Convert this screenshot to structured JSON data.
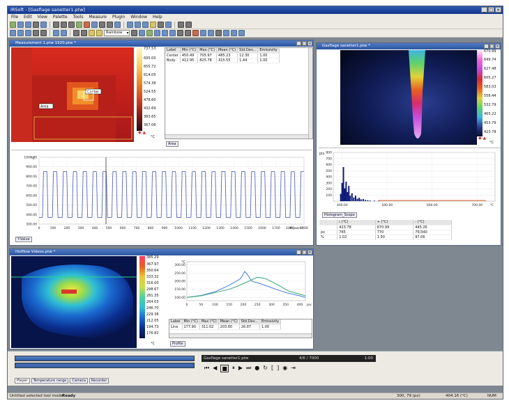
{
  "app": {
    "title": "IRSoft - [Gasflage sanetter1.ptw]"
  },
  "menu": [
    "File",
    "Edit",
    "View",
    "Palette",
    "Tools",
    "Measure",
    "Plugin",
    "Window",
    "Help"
  ],
  "toolbar": {
    "palette_combo": "Rainbow"
  },
  "win_a": {
    "title": "Measurement 1.ptw 1920.ptw *",
    "label_center": "Center",
    "label_area": "Area",
    "cbar_max": "737.53",
    "cbar_ticks": [
      "695.00",
      "655.72",
      "614.05",
      "574.38",
      "524.55",
      "478.60",
      "432.69",
      "383.65"
    ],
    "cbar_min": "367.06",
    "cbar_unit": "°C",
    "table": {
      "headers": [
        "Label",
        "Min (°C)",
        "Max (°C)",
        "Mean (°C)",
        "Std.Dev...",
        "Emissivity"
      ],
      "rows": [
        [
          "Center",
          "450.49",
          "705.97",
          "485.23",
          "12.30",
          "1.00"
        ],
        [
          "Body",
          "412.95",
          "825.78",
          "415.55",
          "1.44",
          "1.00"
        ]
      ]
    },
    "tab": "Area"
  },
  "win_b": {
    "title": "Gasflage sanetter1.ptw *",
    "cbar_max": "670.99",
    "cbar_ticks": [
      "649.74",
      "627.48",
      "605.27",
      "583.03",
      "558.44",
      "532.79",
      "465.22",
      "453.79"
    ],
    "cbar_min": "423.78",
    "cbar_unit": "°C"
  },
  "line_profile": {
    "unit": "°C",
    "xlabel": "ft-jawrel",
    "legend": "Y-Value",
    "chart_data": {
      "type": "line",
      "ylim": [
        300,
        1000
      ],
      "yticks": [
        "1000.00",
        "900.00",
        "800.00",
        "700.00",
        "600.00",
        "500.00",
        "400.00",
        "300.00"
      ],
      "xticks": [
        "0",
        "100",
        "200",
        "300",
        "400",
        "500",
        "600",
        "700",
        "800",
        "900",
        "1000",
        "1100",
        "1200",
        "1300",
        "1400",
        "1500",
        "1600",
        "1700",
        "1800",
        "1900"
      ],
      "xlim": [
        0,
        1900
      ],
      "period": 71,
      "low": 370,
      "high": 850
    }
  },
  "histogram": {
    "unit": "pix",
    "xlabel": "°C",
    "legend": "Histogram_Scope",
    "chart_data": {
      "type": "bar",
      "yticks": [
        "800",
        "700",
        "600",
        "500",
        "400",
        "300",
        "200",
        "100"
      ],
      "xticks": [
        "400.00",
        "500.00",
        "600.00",
        "700.00"
      ],
      "xlim": [
        380,
        740
      ],
      "ylim": [
        0,
        800
      ],
      "bins_x": [
        395,
        398,
        401,
        404,
        407,
        410,
        413,
        416,
        420,
        424,
        428,
        432,
        436,
        440,
        445,
        450,
        455,
        460,
        470,
        480
      ],
      "bins_y": [
        120,
        300,
        560,
        210,
        320,
        150,
        250,
        90,
        130,
        60,
        90,
        40,
        55,
        30,
        35,
        20,
        15,
        10,
        8,
        5
      ]
    },
    "stats": {
      "headers": [
        "",
        "ι (°C)",
        "+ (°C)",
        "- (°C)"
      ],
      "rows": [
        [
          "",
          "423.78",
          "670.99",
          "445.26"
        ],
        [
          "px",
          "765",
          "770",
          "75/340"
        ],
        [
          "%",
          "1.02",
          "1.00",
          "97.06"
        ]
      ]
    }
  },
  "win_c": {
    "title": "Hotflow Videos.ptw *",
    "cbar_max": "385.29",
    "cbar_ticks": [
      "367.97",
      "350.64",
      "333.32",
      "316.00",
      "298.67",
      "281.35",
      "264.03",
      "246.70",
      "229.38",
      "212.05",
      "194.73"
    ],
    "cbar_min": "176.82",
    "cbar_unit": "°C",
    "profile": {
      "unit": "°C",
      "xlabel": "pix",
      "chart_data": {
        "type": "line",
        "yticks": [
          "300.00",
          "250.00",
          "200.00",
          "150.00",
          "100.00"
        ],
        "xticks": [
          "0",
          "50",
          "100",
          "150",
          "200",
          "250",
          "300",
          "350",
          "400"
        ],
        "xlim": [
          0,
          420
        ],
        "ylim": [
          80,
          320
        ],
        "series": [
          {
            "color": "#3c7ae0",
            "x": [
              0,
              50,
              100,
              150,
              190,
              205,
              215,
              230,
              260,
              300,
              350,
              400,
              420
            ],
            "y": [
              100,
              112,
              135,
              175,
              215,
              260,
              240,
              200,
              185,
              160,
              130,
              110,
              100
            ]
          },
          {
            "color": "#3aa87a",
            "x": [
              0,
              50,
              100,
              150,
              180,
              220,
              250,
              280,
              320,
              360,
              420
            ],
            "y": [
              100,
              110,
              130,
              150,
              170,
              200,
              225,
              215,
              180,
              140,
              110
            ]
          }
        ]
      }
    },
    "table": {
      "headers": [
        "Label",
        "Min (°C)",
        "Max (°C)",
        "Mean (°C)",
        "Std.Dev...",
        "Emissivity"
      ],
      "rows": [
        [
          "Line",
          "177.90",
          "311.02",
          "203.60",
          "26.87",
          "1.00"
        ]
      ]
    },
    "tab": "Profile"
  },
  "player": {
    "file": "Gasflage sanetter1.ptw",
    "frame": "4/6 / 7000",
    "timecode": "1:00",
    "tabs": [
      "Player",
      "Temperature range",
      "Camera",
      "Recorder"
    ]
  },
  "status": {
    "left": "Untitled selected tool mode",
    "mode": "Ready",
    "pos": "300, 79 (px)",
    "temp": "404.16 (°C)",
    "num": "NUM"
  },
  "colors": {
    "title": "#13388c",
    "window": "#7f8791",
    "line_series": "#5566bb",
    "hist_bar": "#0d1a7a"
  }
}
